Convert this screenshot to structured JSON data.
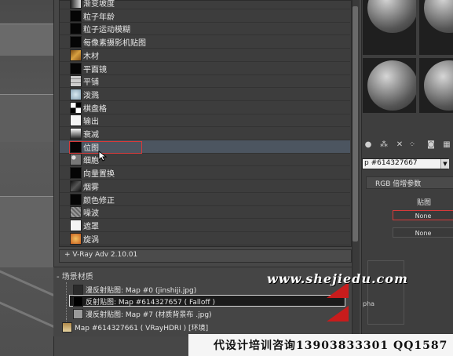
{
  "map_browser": {
    "items": [
      {
        "label": "渐变坡度",
        "swatch": "ramp"
      },
      {
        "label": "粒子年龄",
        "swatch": "black"
      },
      {
        "label": "粒子运动模糊",
        "swatch": "black"
      },
      {
        "label": "每像素摄影机贴图",
        "swatch": "black"
      },
      {
        "label": "木材",
        "swatch": "wood"
      },
      {
        "label": "平面镜",
        "swatch": "black"
      },
      {
        "label": "平铺",
        "swatch": "tiles"
      },
      {
        "label": "泼溅",
        "swatch": "splat"
      },
      {
        "label": "棋盘格",
        "swatch": "checker"
      },
      {
        "label": "输出",
        "swatch": "white"
      },
      {
        "label": "衰减",
        "swatch": "falloff"
      },
      {
        "label": "位图",
        "swatch": "black"
      },
      {
        "label": "细胞",
        "swatch": "cellular"
      },
      {
        "label": "向量置换",
        "swatch": "black"
      },
      {
        "label": "烟雾",
        "swatch": "smoke"
      },
      {
        "label": "颜色修正",
        "swatch": "black"
      },
      {
        "label": "噪波",
        "swatch": "noise"
      },
      {
        "label": "遮罩",
        "swatch": "white"
      },
      {
        "label": "旋涡",
        "swatch": "swirl"
      }
    ],
    "selected_index": 11,
    "vray_group": "+ V-Ray Adv 2.10.01"
  },
  "scene_materials": {
    "title": "- 场景材质",
    "rows": [
      {
        "label": "漫反射贴图: Map #0 (jinshiji.jpg)",
        "selected": false
      },
      {
        "label": "反射贴图: Map #614327657  ( Falloff )",
        "selected": true
      },
      {
        "label": "漫反射贴图: Map #7 (材质背景布 .jpg)",
        "selected": false
      },
      {
        "label": "Map #614327661  ( VRayHDRI )  [环境]",
        "selected": false
      }
    ]
  },
  "right_panel": {
    "map_dropdown": "p #614327667",
    "rgb_header": "RGB 倍增参数",
    "map_label": "贴图",
    "none_buttons": [
      "None",
      "None"
    ],
    "alpha_label": "pha",
    "toolbar_icons": [
      "put-to-scene-icon",
      "assign-icon",
      "reset-icon",
      "unique-icon",
      "background-icon",
      "checker-icon"
    ]
  },
  "overlays": {
    "watermark": "www.shejiedu.com",
    "footer": "代设计培训咨询13903833301 QQ1587"
  },
  "colors": {
    "highlight": "#d83a3a",
    "panel_bg": "#474747",
    "selected_row": "#1b1b1b"
  }
}
